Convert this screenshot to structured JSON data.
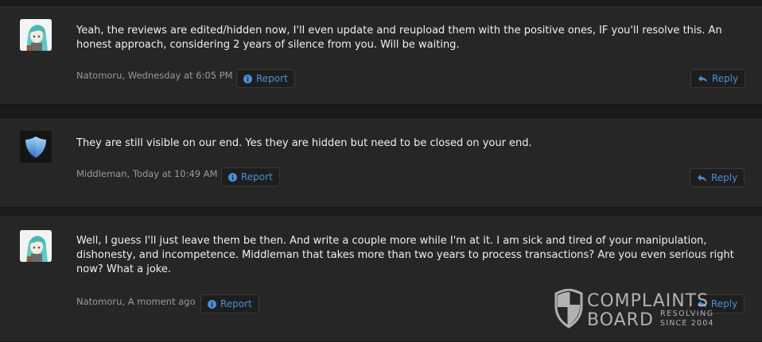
{
  "posts": [
    {
      "message": "Yeah, the reviews are edited/hidden now, I'll even update and reupload them with the positive ones, IF you'll resolve this. An honest approach, considering 2 years of silence from you. Will be waiting.",
      "author": "Natomoru",
      "time": "Wednesday at 6:05 PM",
      "meta": "Natomoru, Wednesday at 6:05 PM",
      "report_label": "Report",
      "reply_label": "Reply",
      "avatar_icon": "anime-avatar"
    },
    {
      "message": "They are still visible on our end. Yes they are hidden but need to be closed on your end.",
      "author": "Middleman",
      "time": "Today at 10:49 AM",
      "meta": "Middleman, Today at 10:49 AM",
      "report_label": "Report",
      "reply_label": "Reply",
      "avatar_icon": "shield-avatar"
    },
    {
      "message": "Well, I guess I'll just leave them be then. And write a couple more while I'm at it. I am sick and tired of your manipulation, dishonesty, and incompetence. Middleman that takes more than two years to process transactions? Are you even serious right now? What a joke.",
      "author": "Natomoru",
      "time": "A moment ago",
      "meta": "Natomoru, A moment ago",
      "report_label": "Report",
      "reply_label": "Reply",
      "avatar_icon": "anime-avatar"
    }
  ],
  "watermark": {
    "line1": "COMPLAINTS",
    "line2": "BOARD",
    "tag1": "RESOLVING",
    "tag2": "SINCE 2004"
  },
  "colors": {
    "accent": "#4a90d9",
    "background": "#1b1b1b",
    "post_background": "#262626",
    "meta_text": "#9a9a9a"
  }
}
